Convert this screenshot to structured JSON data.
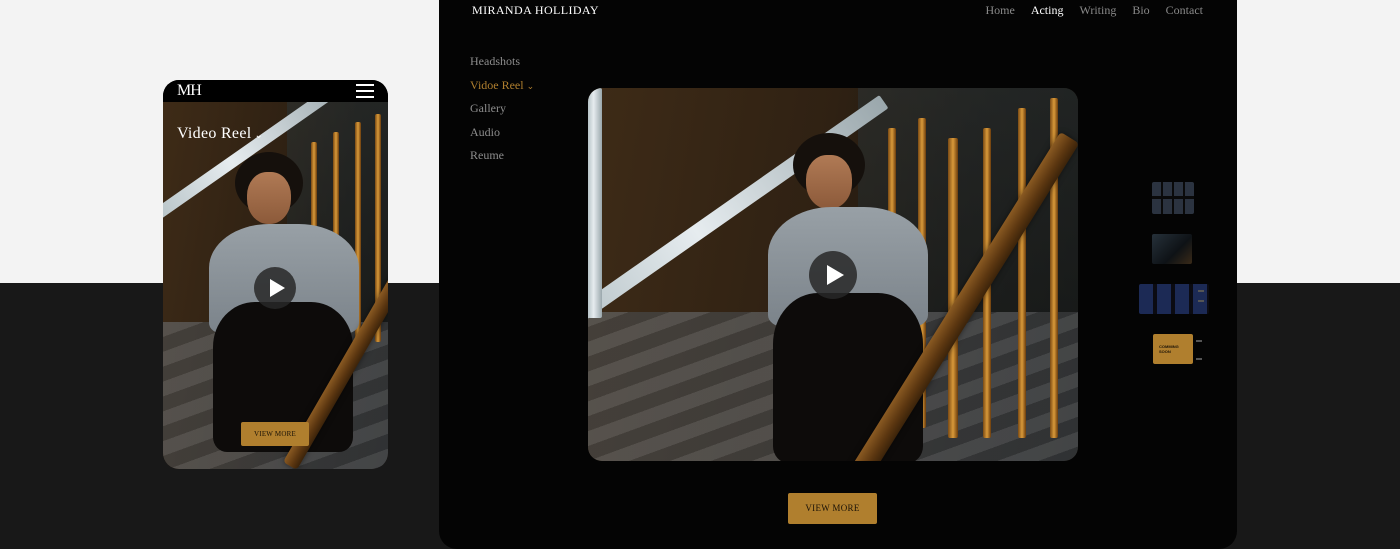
{
  "colors": {
    "accent": "#b07f2e",
    "page_top": "#f3f3f3",
    "page_bottom": "#181818",
    "desktop_bg": "#040404"
  },
  "mobile": {
    "logo": "MH",
    "menu_icon": "hamburger-menu-icon",
    "section_title": "Video Reel",
    "section_chevron": "⌄",
    "play_icon": "play-icon",
    "view_more": "VIEW MORE"
  },
  "desktop": {
    "brand": "MIRANDA HOLLIDAY",
    "nav": [
      "Home",
      "Acting",
      "Writing",
      "Bio",
      "Contact"
    ],
    "nav_active": "Acting",
    "sidebar": [
      "Headshots",
      "Vidoe Reel",
      "Gallery",
      "Audio",
      "Reume"
    ],
    "sidebar_active": "Vidoe Reel",
    "sidebar_chevron": "⌄",
    "play_icon": "play-icon",
    "view_more": "VIEW MORE",
    "thumb_coming_soon": "COMMING SOON"
  }
}
